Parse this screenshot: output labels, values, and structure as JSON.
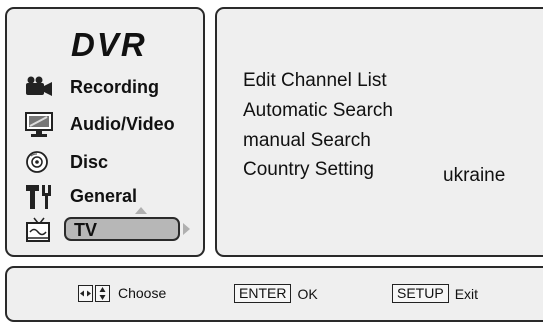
{
  "left_menu": {
    "title": "DVR",
    "items": [
      {
        "label": "Recording",
        "icon": "camcorder-icon"
      },
      {
        "label": "Audio/Video",
        "icon": "monitor-icon"
      },
      {
        "label": "Disc",
        "icon": "disc-icon"
      },
      {
        "label": "General",
        "icon": "tools-icon"
      },
      {
        "label": "TV",
        "icon": "tv-icon",
        "selected": true
      }
    ]
  },
  "right_panel": {
    "options": [
      {
        "label": "Edit Channel List"
      },
      {
        "label": "Automatic Search"
      },
      {
        "label": "manual Search"
      },
      {
        "label": "Country Setting",
        "value": "ukraine"
      }
    ]
  },
  "footer": {
    "choose_label": "Choose",
    "enter_key": "ENTER",
    "enter_label": "OK",
    "setup_key": "SETUP",
    "setup_label": "Exit"
  },
  "colors": {
    "panel_bg": "#efefef",
    "border": "#2a2a2a",
    "highlight": "#b7b7b7"
  }
}
